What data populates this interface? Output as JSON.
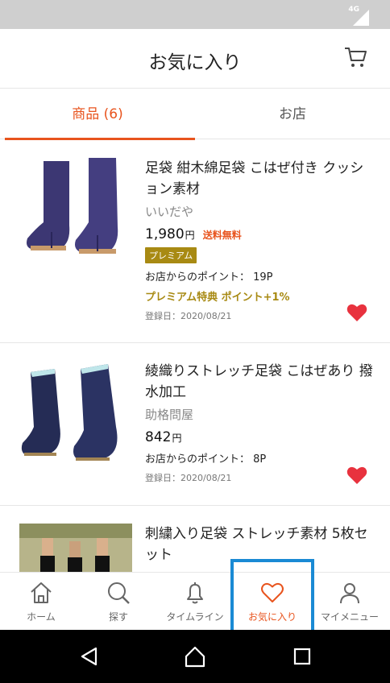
{
  "status": {
    "network": "4G"
  },
  "header": {
    "title": "お気に入り"
  },
  "tabs": [
    {
      "label": "商品 (6)",
      "active": true
    },
    {
      "label": "お店",
      "active": false
    }
  ],
  "items": [
    {
      "name": "足袋 紺木綿足袋 こはぜ付き クッション素材",
      "shop": "いいだや",
      "price": "1,980",
      "yen": "円",
      "shipping": "送料無料",
      "badge": "プレミアム",
      "points": "お店からのポイント： 19P",
      "bonus": "プレミアム特典 ポイント+1%",
      "date": "登録日：2020/08/21"
    },
    {
      "name": "綾織りストレッチ足袋 こはぜあり 撥水加工",
      "shop": "助格問屋",
      "price": "842",
      "yen": "円",
      "points": "お店からのポイント：  8P",
      "date": "登録日：2020/08/21"
    },
    {
      "name": "刺繍入り足袋 ストレッチ素材 5枚セット"
    }
  ],
  "nav": [
    {
      "label": "ホーム",
      "icon": "home-icon"
    },
    {
      "label": "探す",
      "icon": "search-icon"
    },
    {
      "label": "タイムライン",
      "icon": "bell-icon"
    },
    {
      "label": "お気に入り",
      "icon": "heart-icon",
      "active": true
    },
    {
      "label": "マイメニュー",
      "icon": "person-icon"
    }
  ],
  "colors": {
    "accent": "#e8541e",
    "premium": "#a88a13",
    "heart": "#e8323e",
    "highlight": "#1a8ad4"
  }
}
